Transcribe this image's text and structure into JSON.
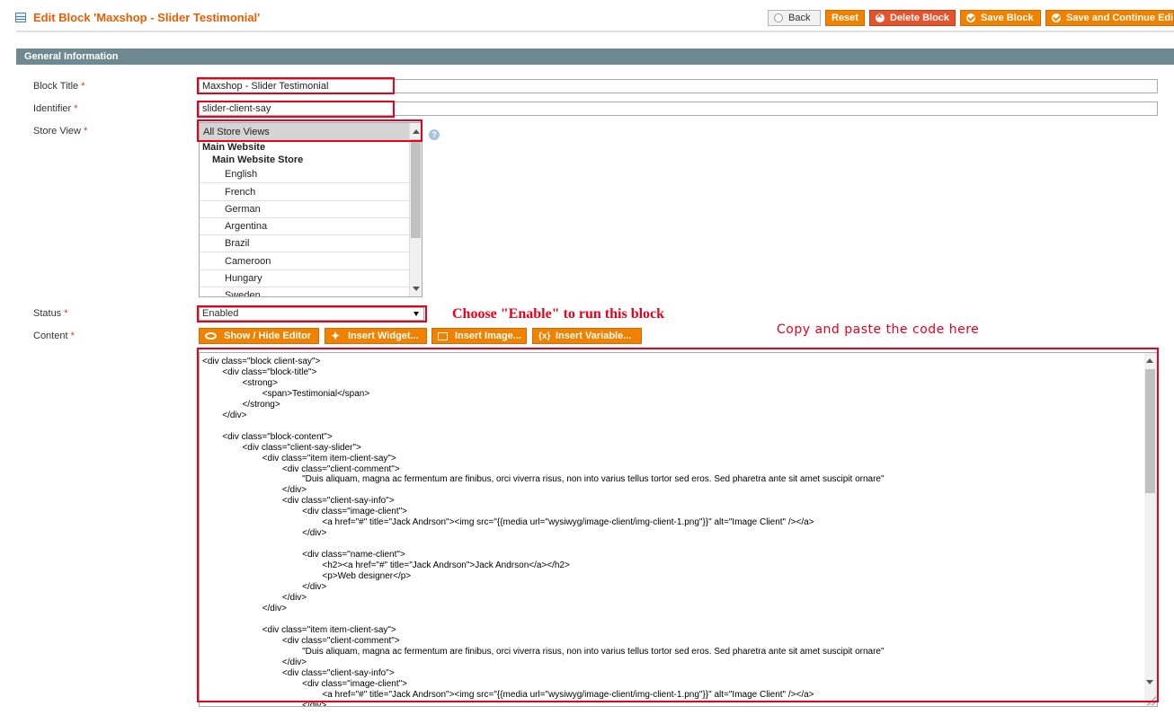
{
  "header": {
    "title": "Edit Block 'Maxshop - Slider Testimonial'",
    "buttons": {
      "back": "Back",
      "reset": "Reset",
      "delete": "Delete Block",
      "save": "Save Block",
      "save_continue": "Save and Continue Edi"
    }
  },
  "section": {
    "title": "General Information"
  },
  "form": {
    "block_title": {
      "label": "Block Title",
      "required": "*",
      "value": "Maxshop - Slider Testimonial"
    },
    "identifier": {
      "label": "Identifier",
      "required": "*",
      "value": "slider-client-say"
    },
    "store_view": {
      "label": "Store View",
      "required": "*",
      "help": "?",
      "selected": "All Store Views",
      "website": "Main Website",
      "store": "Main Website Store",
      "views": [
        "English",
        "French",
        "German",
        "Argentina",
        "Brazil",
        "Cameroon",
        "Hungary",
        "Sweden"
      ]
    },
    "status": {
      "label": "Status",
      "required": "*",
      "value": "Enabled"
    },
    "content": {
      "label": "Content",
      "required": "*",
      "buttons": {
        "show_hide": "Show / Hide Editor",
        "widget": "Insert Widget...",
        "image": "Insert Image...",
        "variable": "Insert Variable..."
      },
      "code": "<div class=\"block client-say\">\n        <div class=\"block-title\">\n                <strong>\n                        <span>Testimonial</span>\n                </strong>\n        </div>\n\n        <div class=\"block-content\">\n                <div class=\"client-say-slider\">\n                        <div class=\"item item-client-say\">\n                                <div class=\"client-comment\">\n                                        \"Duis aliquam, magna ac fermentum are finibus, orci viverra risus, non into varius tellus tortor sed eros. Sed pharetra ante sit amet suscipit ornare\"\n                                </div>\n                                <div class=\"client-say-info\">\n                                        <div class=\"image-client\">\n                                                <a href=\"#\" title=\"Jack Andrson\"><img src=\"{{media url=\"wysiwyg/image-client/img-client-1.png\"}}\" alt=\"Image Client\" /></a>\n                                        </div>\n\n                                        <div class=\"name-client\">\n                                                <h2><a href=\"#\" title=\"Jack Andrson\">Jack Andrson</a></h2>\n                                                <p>Web designer</p>\n                                        </div>\n                                </div>\n                        </div>\n\n                        <div class=\"item item-client-say\">\n                                <div class=\"client-comment\">\n                                        \"Duis aliquam, magna ac fermentum are finibus, orci viverra risus, non into varius tellus tortor sed eros. Sed pharetra ante sit amet suscipit ornare\"\n                                </div>\n                                <div class=\"client-say-info\">\n                                        <div class=\"image-client\">\n                                                <a href=\"#\" title=\"Jack Andrson\"><img src=\"{{media url=\"wysiwyg/image-client/img-client-1.png\"}}\" alt=\"Image Client\" /></a>\n                                        </div>"
    }
  },
  "annotations": {
    "status_note": "Choose \"Enable\" to run this block",
    "content_note": "Copy and paste the code here"
  },
  "colors": {
    "accent": "#f18200",
    "title": "#eb5e00",
    "annotation": "#e8001c",
    "section_bar": "#6f8992"
  }
}
